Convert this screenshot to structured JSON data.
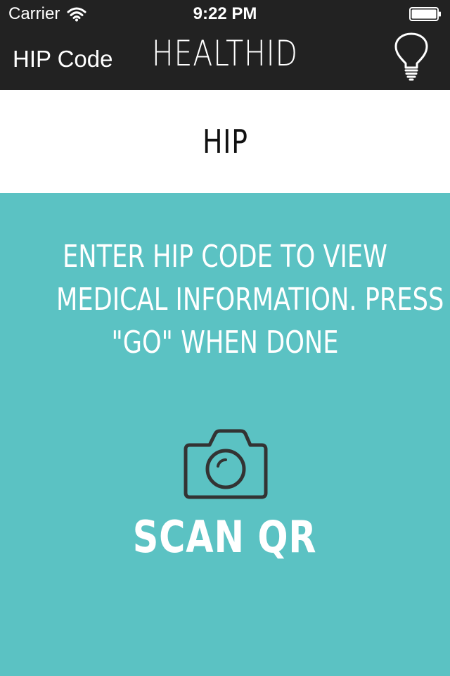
{
  "status_bar": {
    "carrier": "Carrier",
    "time": "9:22 PM",
    "wifi_icon": "wifi-icon",
    "battery_icon": "battery-icon"
  },
  "nav": {
    "back_label": "HIP Code",
    "title": "HEALTHID",
    "hint_icon": "lightbulb-icon"
  },
  "field": {
    "value": "HIP"
  },
  "instructions": {
    "lines": [
      "ENTER HIP CODE TO VIEW",
      "MEDICAL INFORMATION. PRESS",
      "\"GO\" WHEN DONE"
    ]
  },
  "scan": {
    "icon": "camera-icon",
    "label": "SCAN QR"
  },
  "colors": {
    "header_bg": "#222222",
    "body_bg": "#5bc2c3",
    "field_bg": "#ffffff",
    "icon_stroke": "#333333",
    "text_light": "#ffffff"
  }
}
